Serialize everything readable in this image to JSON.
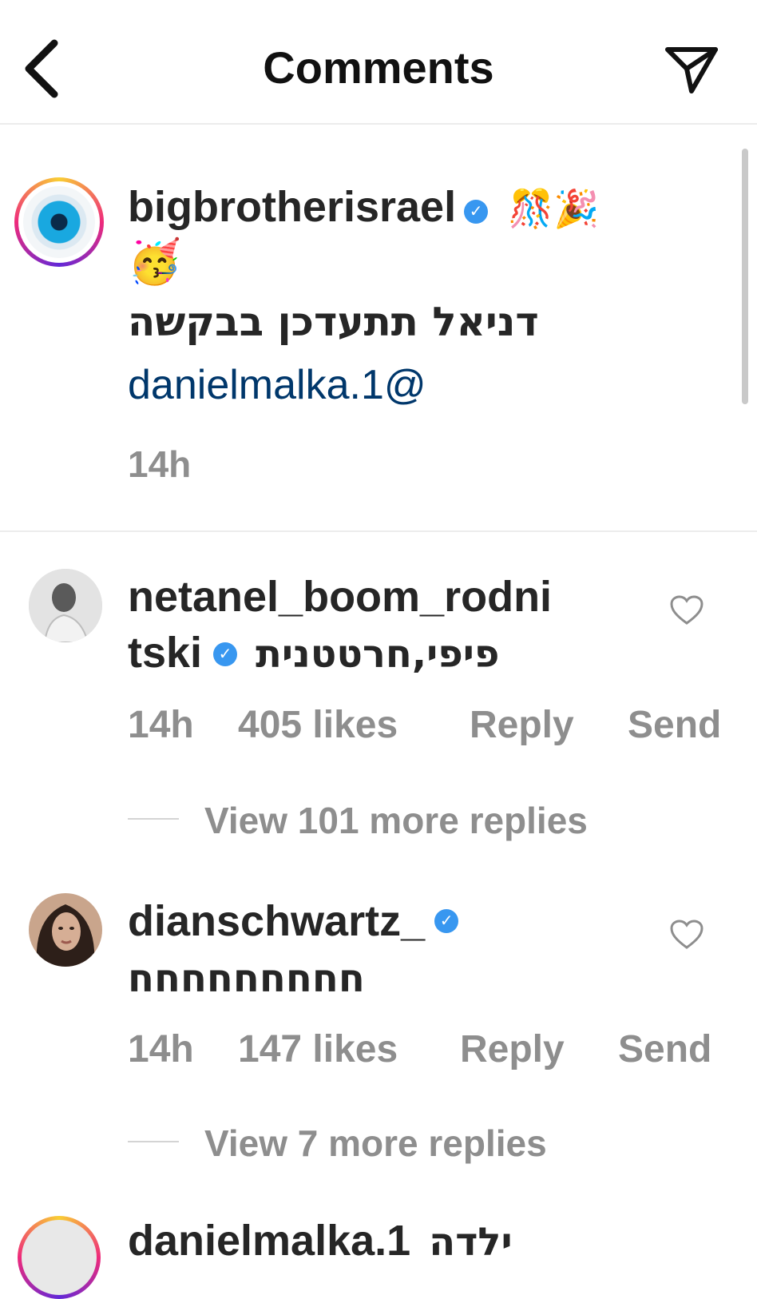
{
  "header": {
    "title": "Comments",
    "back_icon": "chevron-left-icon",
    "send_icon": "paper-plane-icon"
  },
  "caption": {
    "username": "bigbrotherisrael",
    "verified": true,
    "emojis_line1": "🎊🎉",
    "emojis_line2": "🥳",
    "text": "דניאל תתעדכן בבקשה",
    "mention": "danielmalka.1@",
    "time": "14h"
  },
  "comments": [
    {
      "username_line1": "netanel_boom_rodni",
      "username_line2": "tski",
      "verified": true,
      "text": "פיפי,חרטטנית",
      "time": "14h",
      "likes": "405 likes",
      "reply": "Reply",
      "send": "Send",
      "view_replies": "View 101 more replies"
    },
    {
      "username": "dianschwartz_",
      "verified": true,
      "text": "חחחחחחחחח",
      "time": "14h",
      "likes": "147 likes",
      "reply": "Reply",
      "send": "Send",
      "view_replies": "View 7 more replies"
    },
    {
      "username": "danielmalka.1",
      "text": "ילדה"
    }
  ],
  "colors": {
    "mention": "#00376b",
    "meta": "#8e8e8e",
    "verified": "#3897f0"
  }
}
